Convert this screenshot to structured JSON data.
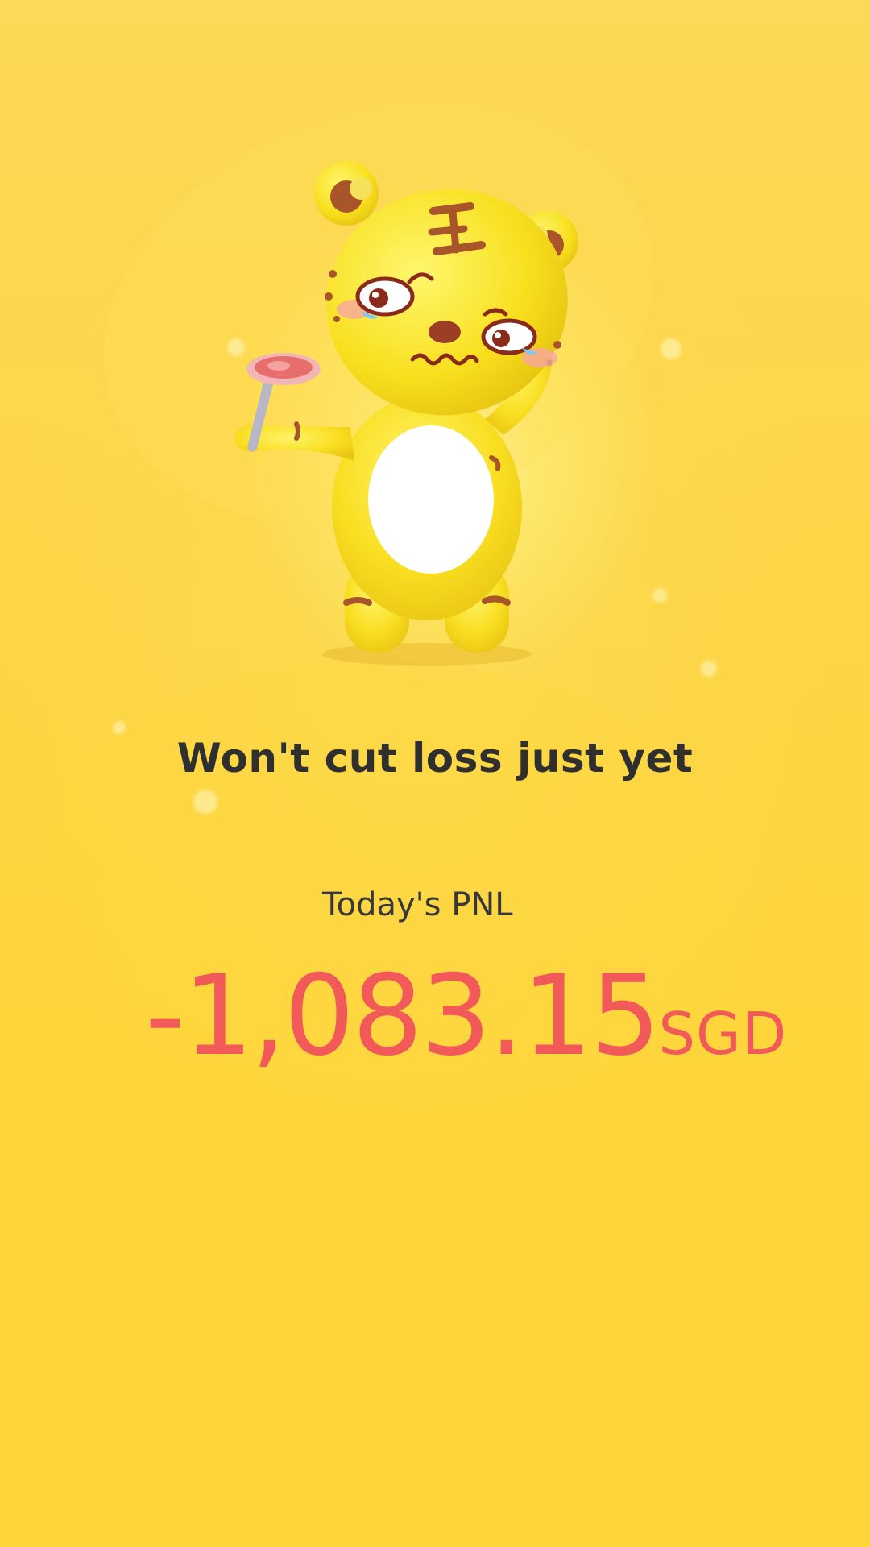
{
  "mascot": {
    "icon": "tiger-mascot-holding-meat-icon",
    "colors": {
      "body": "#f9df22",
      "belly": "#ffffff",
      "stripes": "#a8552a",
      "meat": "#e86d6d"
    }
  },
  "headline": "Won't cut loss just yet",
  "pnl": {
    "label": "Today's PNL",
    "amount": "-1,083.15",
    "currency": "SGD",
    "color": "#f25a5a"
  },
  "colors": {
    "background": "#fdd844",
    "text_dark": "#2f2f2f"
  }
}
